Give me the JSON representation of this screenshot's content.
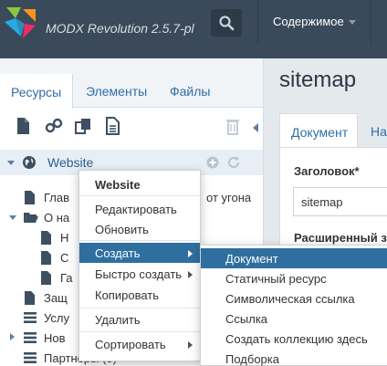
{
  "header": {
    "app_title": "MODX Revolution 2.5.7-pl",
    "nav_content": "Содержимое"
  },
  "left_panel": {
    "tabs": [
      "Ресурсы",
      "Элементы",
      "Файлы"
    ],
    "tree_root": "Website",
    "tree_items": [
      {
        "label": "Глав",
        "icon": "file-icon"
      },
      {
        "label": "О на",
        "icon": "folder-open-icon"
      },
      {
        "label": "Н",
        "icon": "file-icon"
      },
      {
        "label": "С",
        "icon": "file-icon"
      },
      {
        "label": "Га",
        "icon": "file-icon"
      },
      {
        "label": "Защ",
        "icon": "file-icon"
      },
      {
        "label": "Услу",
        "icon": "list-icon"
      },
      {
        "label": "Нов",
        "icon": "list-icon"
      },
      {
        "label": "Партнеры (0)",
        "icon": "list-icon"
      }
    ],
    "partial_text_right": "от угона"
  },
  "context_menu": {
    "header": "Website",
    "items": [
      "Редактировать",
      "Обновить",
      "Создать",
      "Быстро создать",
      "Копировать",
      "Удалить",
      "Сортировать"
    ]
  },
  "submenu": {
    "items": [
      "Документ",
      "Статичный ресурс",
      "Символическая ссылка",
      "Ссылка",
      "Создать коллекцию здесь",
      "Подборка"
    ]
  },
  "right_panel": {
    "page_title": "sitemap",
    "tab_active": "Документ",
    "tab_next": "На",
    "field_title_label": "Заголовок*",
    "field_title_value": "sitemap",
    "field_ext_label": "Расширенный з"
  },
  "colors": {
    "topbar": "#3a4a5a",
    "menu_active": "#2f6f9f",
    "link": "#2e6ea6"
  }
}
